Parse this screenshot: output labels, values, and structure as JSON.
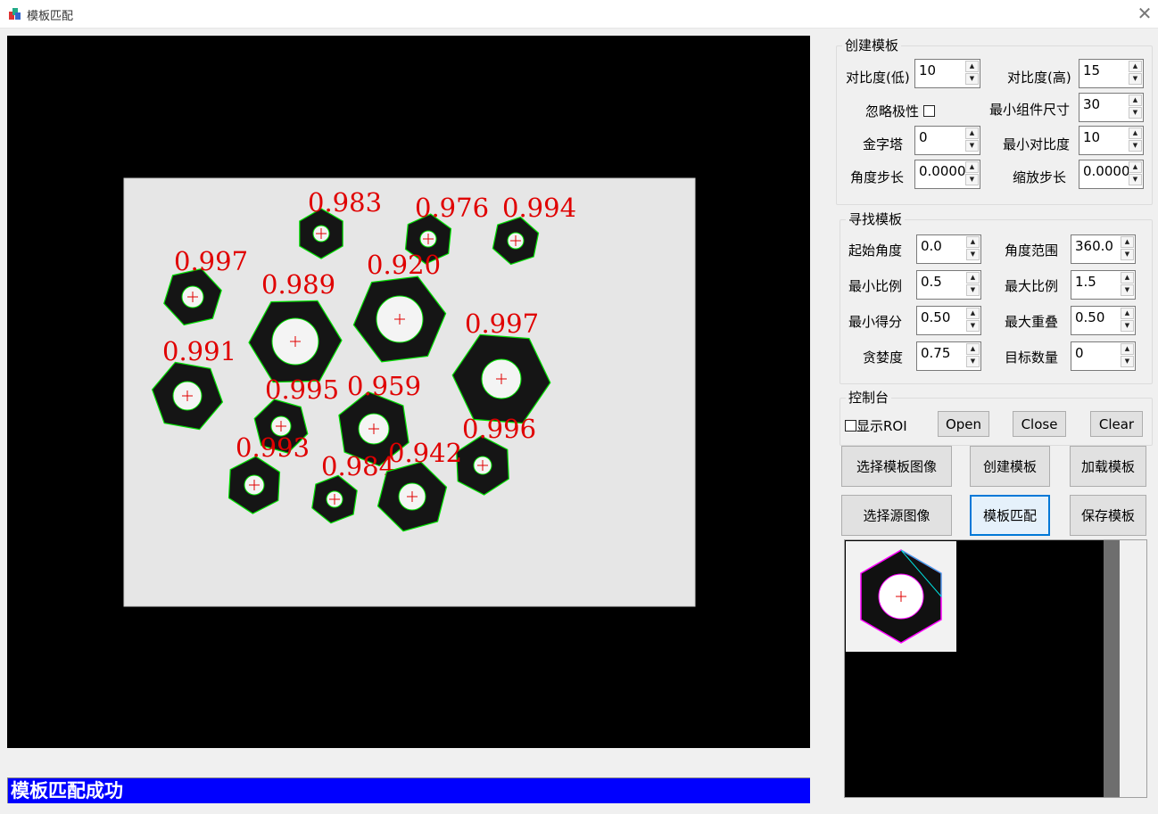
{
  "window": {
    "title": "模板匹配",
    "close_glyph": "✕"
  },
  "main_image": {
    "scores": [
      "0.983",
      "0.976",
      "0.994",
      "0.997",
      "0.920",
      "0.989",
      "0.997",
      "0.991",
      "0.995",
      "0.959",
      "0.996",
      "0.993",
      "0.984",
      "0.942"
    ]
  },
  "status": {
    "message": "模板匹配成功",
    "bg_color": "#0000ff"
  },
  "create_template": {
    "title": "创建模板",
    "contrast_low_label": "对比度(低)",
    "contrast_low_value": "10",
    "contrast_high_label": "对比度(高)",
    "contrast_high_value": "15",
    "ignore_polarity_label": "忽略极性",
    "min_component_size_label": "最小组件尺寸",
    "min_component_size_value": "30",
    "pyramid_label": "金字塔",
    "pyramid_value": "0",
    "min_contrast_label": "最小对比度",
    "min_contrast_value": "10",
    "angle_step_label": "角度步长",
    "angle_step_value": "0.0000",
    "scale_step_label": "缩放步长",
    "scale_step_value": "0.0000"
  },
  "find_template": {
    "title": "寻找模板",
    "start_angle_label": "起始角度",
    "start_angle_value": "0.0",
    "angle_range_label": "角度范围",
    "angle_range_value": "360.0",
    "min_scale_label": "最小比例",
    "min_scale_value": "0.5",
    "max_scale_label": "最大比例",
    "max_scale_value": "1.5",
    "min_score_label": "最小得分",
    "min_score_value": "0.50",
    "max_overlap_label": "最大重叠",
    "max_overlap_value": "0.50",
    "greediness_label": "贪婪度",
    "greediness_value": "0.75",
    "target_count_label": "目标数量",
    "target_count_value": "0"
  },
  "console": {
    "title": "控制台",
    "show_roi_label": "显示ROI",
    "open_label": "Open",
    "close_label": "Close",
    "clear_label": "Clear"
  },
  "actions": {
    "select_template_image": "选择模板图像",
    "create_template": "创建模板",
    "load_template": "加载模板",
    "select_source_image": "选择源图像",
    "template_match": "模板匹配",
    "save_template": "保存模板"
  },
  "colors": {
    "accent": "#0078d7",
    "score_text": "#e00000",
    "contour": "#00ff00"
  }
}
